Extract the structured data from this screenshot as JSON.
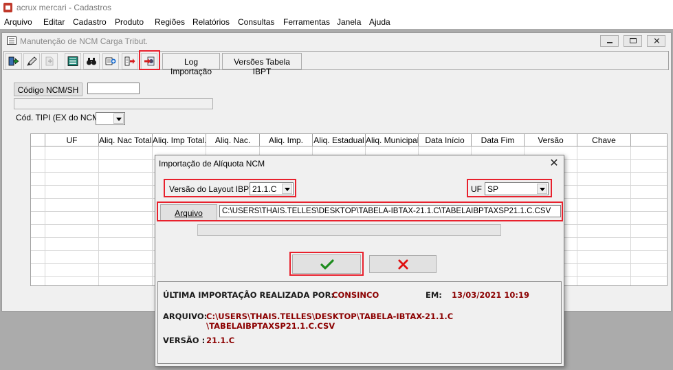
{
  "app": {
    "title": "acrux mercari - Cadastros",
    "menu": [
      "Arquivo",
      "Editar",
      "Cadastro",
      "Produto",
      "Regiões",
      "Relatórios",
      "Consultas",
      "Ferramentas",
      "Janela",
      "Ajuda"
    ]
  },
  "window": {
    "title": "Manutenção de NCM Carga Tribut.",
    "toolbar": {
      "icons": [
        "exit-icon",
        "edit-icon",
        "new-icon",
        "list-icon",
        "binoculars-icon",
        "add-icon",
        "export-icon",
        "import-icon"
      ],
      "log_label": "Log Importação",
      "versions_label": "Versões Tabela IBPT"
    },
    "filters": {
      "ncm_button": "Código NCM/SH",
      "ncm_value": "",
      "tipi_label": "Cód. TIPI (EX do NCM)",
      "tipi_value": ""
    },
    "grid": {
      "columns": [
        "UF",
        "Aliq. Nac Total.",
        "Aliq. Imp Total.",
        "Aliq. Nac.",
        "Aliq. Imp.",
        "Aliq. Estadual",
        "Aliq. Municipal",
        "Data Início",
        "Data Fim",
        "Versão",
        "Chave"
      ],
      "rows": []
    }
  },
  "dialog": {
    "title": "Importação de Alíquota NCM",
    "layout_label": "Versão do Layout IBPT",
    "layout_value": "21.1.C",
    "uf_label": "UF",
    "uf_value": "SP",
    "file_button": "Arquivo",
    "file_path": "C:\\USERS\\THAIS.TELLES\\DESKTOP\\TABELA-IBTAX-21.1.C\\TABELAIBPTAXSP21.1.C.CSV",
    "progress": 0,
    "ok_icon": "check-icon",
    "cancel_icon": "cross-icon",
    "ok_color": "#1e8c1e",
    "cancel_color": "#e01010",
    "last_import": {
      "label": "ÚLTIMA IMPORTAÇÃO REALIZADA POR:",
      "user": "CONSINCO",
      "date_label": "EM:",
      "date": "13/03/2021 10:19",
      "file_label": "ARQUIVO:",
      "file_line1": "C:\\USERS\\THAIS.TELLES\\DESKTOP\\TABELA-IBTAX-21.1.C",
      "file_line2": "\\TABELAIBPTAXSP21.1.C.CSV",
      "version_label": "VERSÃO :",
      "version": "21.1.C"
    }
  },
  "highlight_color": "#e8212d"
}
